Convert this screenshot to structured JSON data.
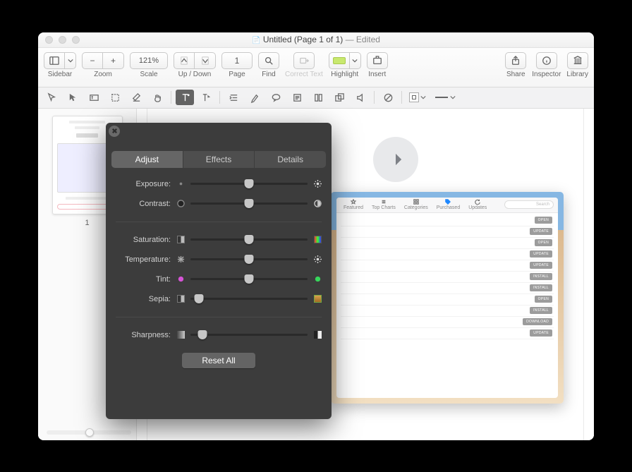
{
  "title": {
    "doc_icon": "📄",
    "name": "Untitled (Page 1 of 1)",
    "status": "— Edited"
  },
  "toolbar": {
    "sidebar": "Sidebar",
    "zoom": "Zoom",
    "scale": "Scale",
    "scale_value": "121%",
    "updown": "Up / Down",
    "page": "Page",
    "page_value": "1",
    "find": "Find",
    "correct_text": "Correct Text",
    "highlight": "Highlight",
    "insert": "Insert",
    "share": "Share",
    "inspector": "Inspector",
    "library": "Library",
    "minus": "−",
    "plus": "+"
  },
  "thumbs": {
    "page_num": "1"
  },
  "doc": {
    "tabs": [
      "Featured",
      "Top Charts",
      "Categories",
      "Purchased",
      "Updates"
    ],
    "search_placeholder": "Search",
    "buttons": [
      "OPEN",
      "UPDATE",
      "OPEN",
      "UPDATE",
      "UPDATE",
      "INSTALL",
      "INSTALL",
      "OPEN",
      "INSTALL",
      "DOWNLOAD",
      "UPDATE"
    ]
  },
  "popover": {
    "tabs": [
      "Adjust",
      "Effects",
      "Details"
    ],
    "active_tab": 0,
    "sliders": [
      {
        "label": "Exposure:",
        "pos": 50,
        "left_icon": "sun-dim",
        "right_icon": "sun-bright"
      },
      {
        "label": "Contrast:",
        "pos": 50,
        "left_icon": "circle-half",
        "right_icon": "circle-half-r"
      },
      {
        "sep": true
      },
      {
        "label": "Saturation:",
        "pos": 50,
        "left_icon": "sq-bw",
        "right_icon": "sq-rainbow"
      },
      {
        "label": "Temperature:",
        "pos": 50,
        "left_icon": "snow",
        "right_icon": "sun-bright"
      },
      {
        "label": "Tint:",
        "pos": 50,
        "left_icon": "dot-magenta",
        "right_icon": "dot-green"
      },
      {
        "label": "Sepia:",
        "pos": 7,
        "left_icon": "sq-bw",
        "right_icon": "sq-sepia"
      },
      {
        "sep": true
      },
      {
        "label": "Sharpness:",
        "pos": 10,
        "left_icon": "blur",
        "right_icon": "sharp"
      }
    ],
    "reset": "Reset All"
  }
}
